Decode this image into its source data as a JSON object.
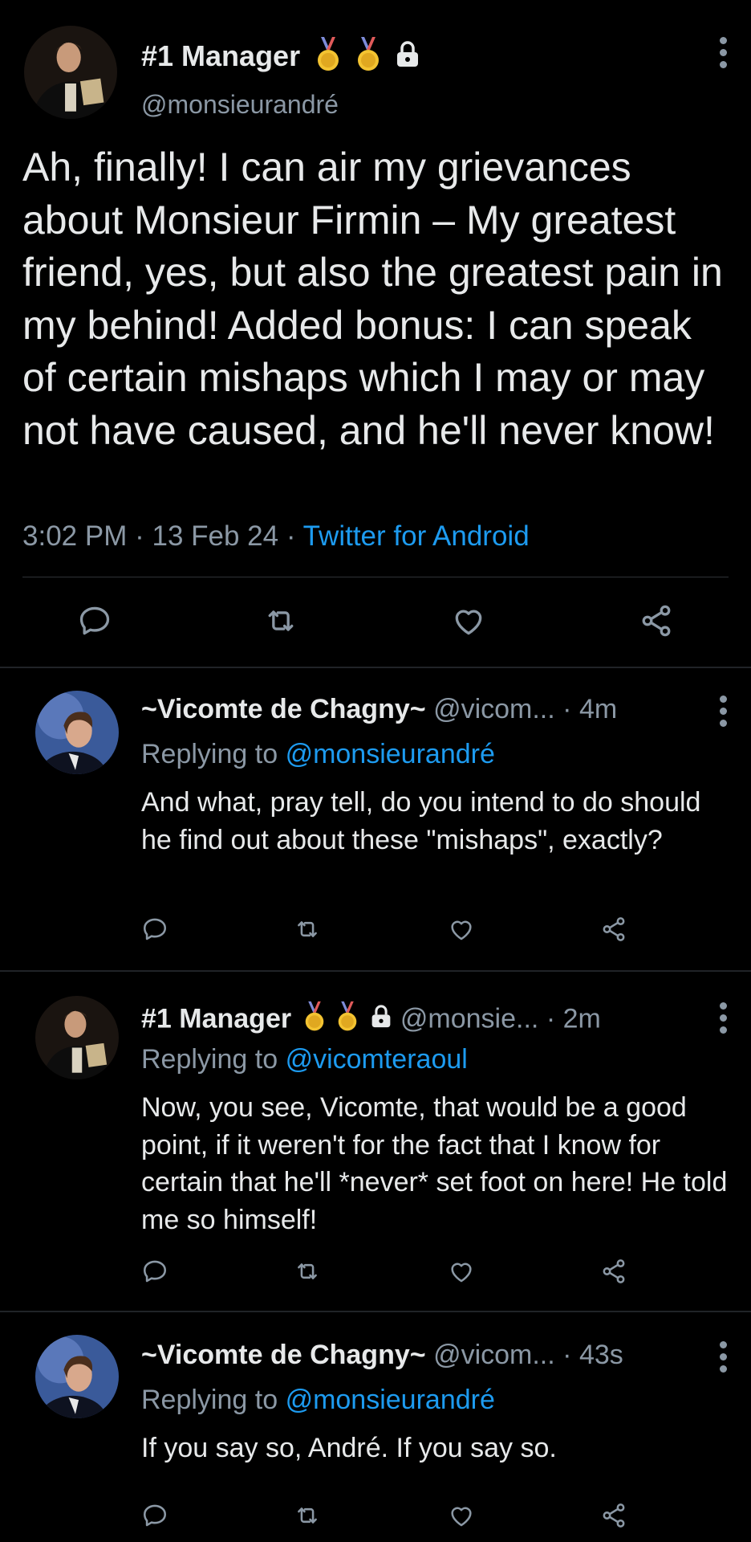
{
  "main_tweet": {
    "author_name": "#1 Manager",
    "handle": "@monsieurandré",
    "text": "Ah, finally! I can air my grievances about Monsieur Firmin – My greatest friend, yes, but also the greatest pain in my behind! Added bonus: I can speak of certain mishaps which I may or may not have caused, and he'll never know!",
    "time": "3:02 PM",
    "date": "13 Feb 24",
    "source": "Twitter for Android",
    "separator": "·"
  },
  "replies": [
    {
      "author_name": "~Vicomte de Chagny~",
      "handle": "@vicom...",
      "age": "4m",
      "replying_prefix": "Replying to",
      "replying_to": "@monsieurandré",
      "text": "And what, pray tell, do you intend to do should he find out about these \"mishaps\", exactly?"
    },
    {
      "author_name": "#1 Manager",
      "handle": "@monsie...",
      "age": "2m",
      "replying_prefix": "Replying to",
      "replying_to": "@vicomteraoul",
      "text": "Now, you see, Vicomte, that would be a good point, if it weren't for the fact that I know for certain that he'll *never* set foot on here! He told me so himself!"
    },
    {
      "author_name": "~Vicomte de Chagny~",
      "handle": "@vicom...",
      "age": "43s",
      "replying_prefix": "Replying to",
      "replying_to": "@monsieurandré",
      "text": "If you say so, André. If you say so."
    }
  ],
  "icons": {
    "reply": "reply-icon",
    "retweet": "retweet-icon",
    "like": "like-icon",
    "share": "share-icon",
    "more": "more-icon",
    "medal": "medal-icon",
    "lock": "lock-icon"
  },
  "colors": {
    "background": "#000000",
    "text": "#e7e9ea",
    "secondary": "#8b98a5",
    "accent": "#1d9bf0",
    "medal": "#f3c331"
  }
}
